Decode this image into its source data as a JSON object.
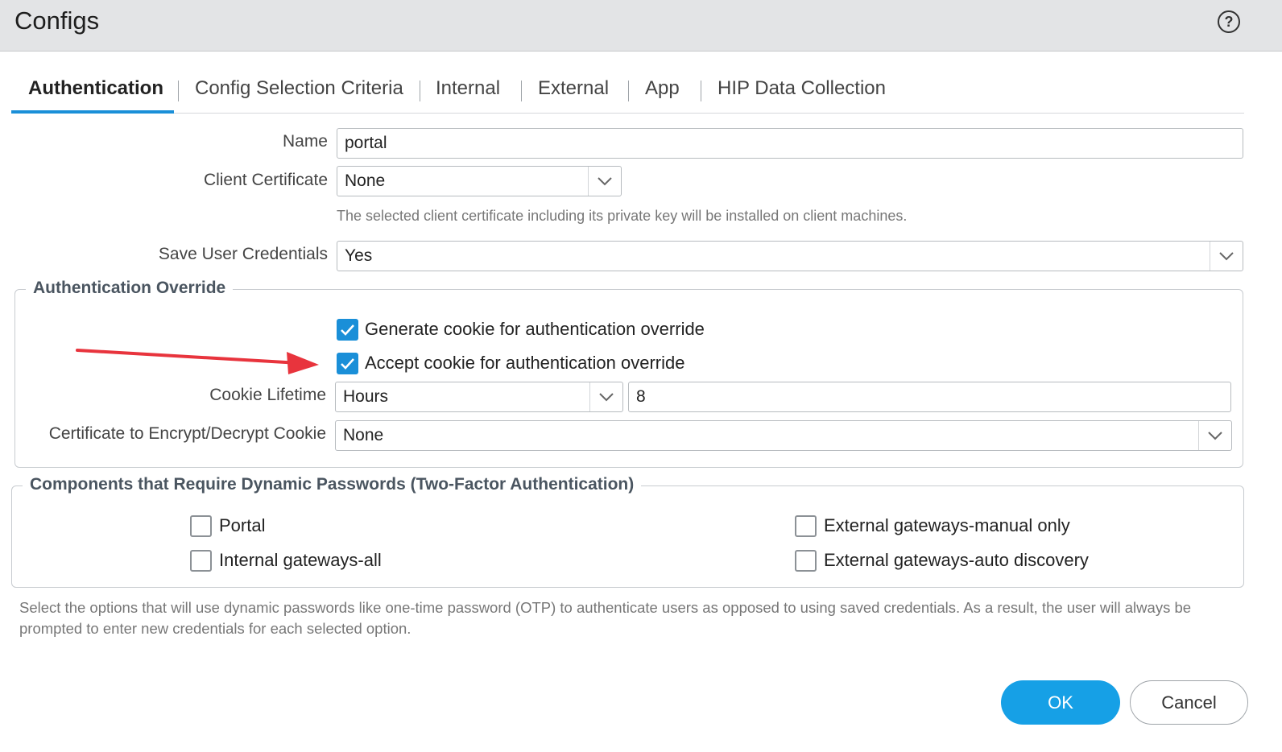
{
  "window": {
    "title": "Configs",
    "help_icon": "question-circle-icon"
  },
  "tabs": [
    {
      "label": "Authentication",
      "active": true
    },
    {
      "label": "Config Selection Criteria"
    },
    {
      "label": "Internal"
    },
    {
      "label": "External"
    },
    {
      "label": "App"
    },
    {
      "label": "HIP Data Collection"
    }
  ],
  "form": {
    "name_label": "Name",
    "name_value": "portal",
    "client_cert_label": "Client Certificate",
    "client_cert_value": "None",
    "client_cert_hint": "The selected client certificate including its private key will be installed on client machines.",
    "save_creds_label": "Save User Credentials",
    "save_creds_value": "Yes"
  },
  "auth_override": {
    "legend": "Authentication Override",
    "generate_cookie_label": "Generate cookie for authentication override",
    "generate_cookie_checked": true,
    "accept_cookie_label": "Accept cookie for authentication override",
    "accept_cookie_checked": true,
    "cookie_lifetime_label": "Cookie Lifetime",
    "cookie_lifetime_unit": "Hours",
    "cookie_lifetime_value": "8",
    "cert_cookie_label": "Certificate to Encrypt/Decrypt Cookie",
    "cert_cookie_value": "None"
  },
  "dynamic_passwords": {
    "legend": "Components that Require Dynamic Passwords (Two-Factor Authentication)",
    "portal_label": "Portal",
    "internal_all_label": "Internal gateways-all",
    "external_manual_label": "External gateways-manual only",
    "external_auto_label": "External gateways-auto discovery",
    "note": "Select the options that will use dynamic passwords like one-time password (OTP) to authenticate users as opposed to using saved credentials. As a result, the user will always be prompted to enter new credentials for each selected option."
  },
  "buttons": {
    "ok": "OK",
    "cancel": "Cancel"
  },
  "colors": {
    "accent": "#1a8fd8",
    "ok_button": "#16a0e6",
    "annotation_arrow": "#e8343d"
  }
}
